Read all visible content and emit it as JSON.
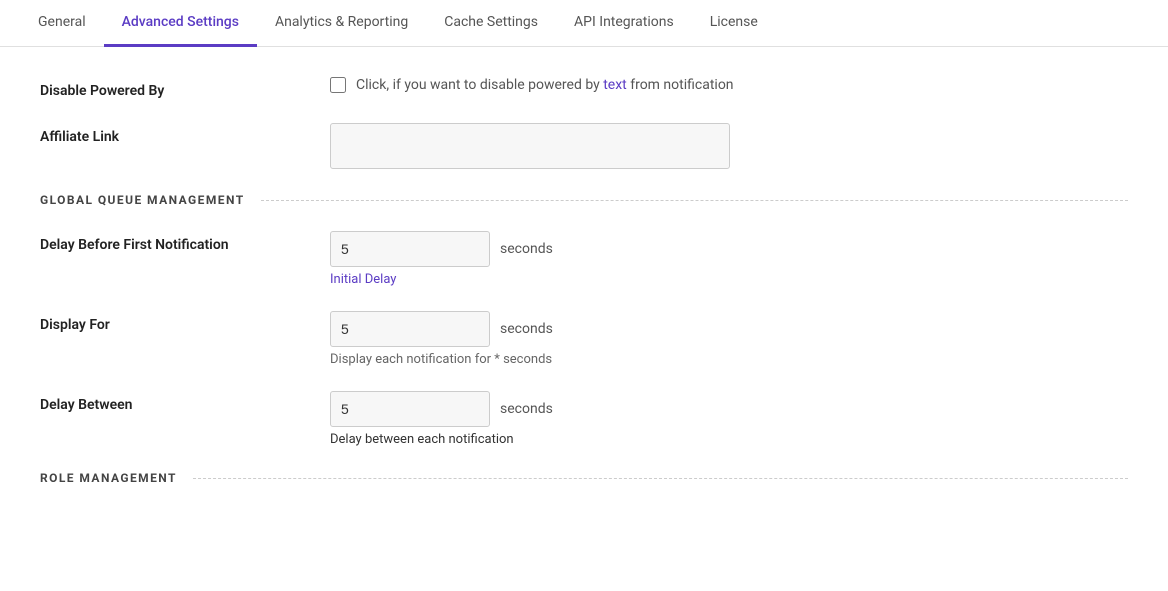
{
  "tabs": [
    {
      "id": "general",
      "label": "General",
      "active": false
    },
    {
      "id": "advanced-settings",
      "label": "Advanced Settings",
      "active": true
    },
    {
      "id": "analytics-reporting",
      "label": "Analytics & Reporting",
      "active": false
    },
    {
      "id": "cache-settings",
      "label": "Cache Settings",
      "active": false
    },
    {
      "id": "api-integrations",
      "label": "API Integrations",
      "active": false
    },
    {
      "id": "license",
      "label": "License",
      "active": false
    }
  ],
  "sections": {
    "disable_powered_by": {
      "label": "Disable Powered By",
      "checkbox_text_before": "Click, if you want to disable powered by ",
      "checkbox_link_text": "text",
      "checkbox_text_after": " from notification"
    },
    "affiliate_link": {
      "label": "Affiliate Link",
      "value": "",
      "placeholder": ""
    },
    "global_queue": {
      "title": "GLOBAL QUEUE MANAGEMENT",
      "delay_before_first": {
        "label": "Delay Before First Notification",
        "value": "5",
        "unit": "seconds",
        "hint": "Initial Delay",
        "hint_color": "blue"
      },
      "display_for": {
        "label": "Display For",
        "value": "5",
        "unit": "seconds",
        "hint": "Display each notification for * seconds",
        "hint_color": "gray"
      },
      "delay_between": {
        "label": "Delay Between",
        "value": "5",
        "unit": "seconds",
        "hint_prefix": "Delay",
        "hint_suffix": " between each notification",
        "hint_color": "blue"
      }
    },
    "role_management": {
      "title": "ROLE MANAGEMENT"
    }
  }
}
